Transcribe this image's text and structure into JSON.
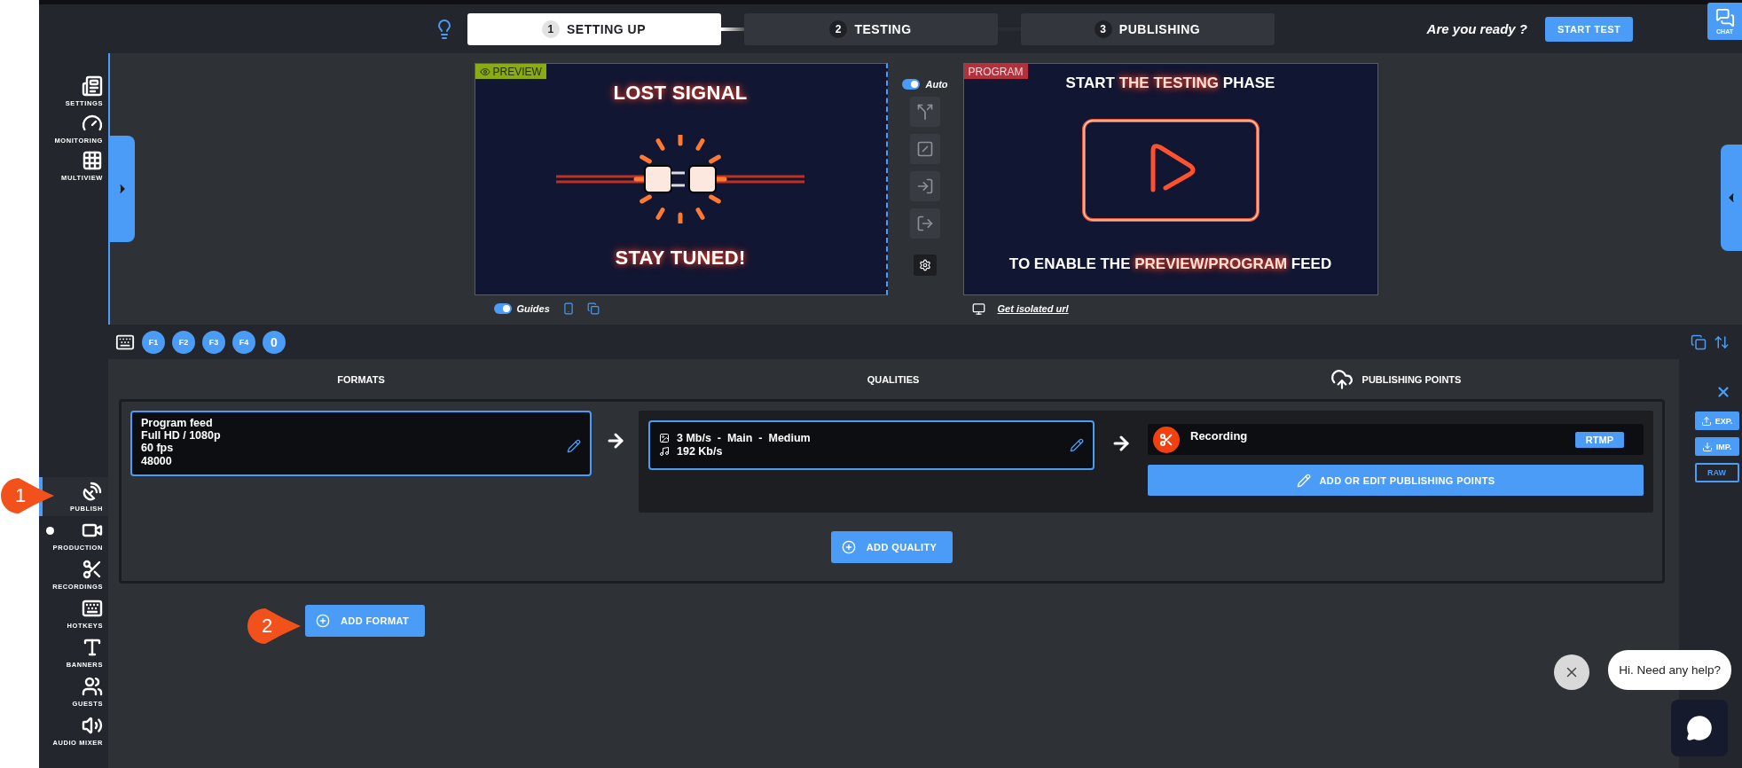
{
  "header": {
    "steps": [
      {
        "number": "1",
        "label": "SETTING UP",
        "selected": true
      },
      {
        "number": "2",
        "label": "TESTING",
        "selected": false
      },
      {
        "number": "3",
        "label": "PUBLISHING",
        "selected": false
      }
    ],
    "prompt": "Are you ready ?",
    "start_button": "START TEST",
    "chat_button": "CHAT"
  },
  "sidebar": {
    "top_items": [
      {
        "label": "SETTINGS",
        "selected": false,
        "live": false
      },
      {
        "label": "MONITORING",
        "selected": false,
        "live": false
      },
      {
        "label": "MULTIVIEW",
        "selected": false,
        "live": false
      }
    ],
    "bottom_items": [
      {
        "label": "PUBLISH",
        "selected": true,
        "live": false
      },
      {
        "label": "PRODUCTION",
        "selected": false,
        "live": true
      },
      {
        "label": "RECORDINGS",
        "selected": false,
        "live": false
      },
      {
        "label": "HOTKEYS",
        "selected": false,
        "live": false
      },
      {
        "label": "BANNERS",
        "selected": false,
        "live": false
      },
      {
        "label": "GUESTS",
        "selected": false,
        "live": false
      },
      {
        "label": "AUDIO MIXER",
        "selected": false,
        "live": false
      }
    ]
  },
  "preview": {
    "label": "PREVIEW",
    "title": "LOST SIGNAL",
    "subtitle": "STAY TUNED!",
    "guides": {
      "label": "Guides",
      "on": true
    }
  },
  "auto": {
    "label": "Auto",
    "on": true
  },
  "program": {
    "label": "PROGRAM",
    "headline": [
      {
        "text": "START ",
        "highlight": false
      },
      {
        "text": "THE TESTING",
        "highlight": true
      },
      {
        "text": " PHASE",
        "highlight": false
      }
    ],
    "footer": [
      {
        "text": "TO ENABLE THE ",
        "highlight": false
      },
      {
        "text": "PREVIEW/PROGRAM",
        "highlight": true
      },
      {
        "text": " FEED",
        "highlight": false
      }
    ],
    "link": "Get isolated url"
  },
  "hotkeys": [
    "F1",
    "F2",
    "F3",
    "F4",
    "0"
  ],
  "columns": [
    "FORMATS",
    "QUALITIES",
    "PUBLISHING POINTS"
  ],
  "format": {
    "lines": [
      "Program feed",
      "Full HD / 1080p",
      "60 fps",
      "48000"
    ]
  },
  "quality": {
    "video": "3 Mb/s  -  Main  -  Medium",
    "audio": "192 Kb/s"
  },
  "publishing_point": {
    "name": "Recording",
    "protocol": "RTMP",
    "edit_button": "ADD OR EDIT PUBLISHING POINTS"
  },
  "add_quality": "ADD QUALITY",
  "add_format": "ADD FORMAT",
  "rail": {
    "buttons": [
      {
        "label": "EXP.",
        "kind": "export"
      },
      {
        "label": "IMP.",
        "kind": "import"
      },
      {
        "label": "RAW",
        "kind": "outline"
      }
    ]
  },
  "annotations": [
    "1",
    "2"
  ],
  "chat_widget": {
    "message": "Hi. Need any help?"
  }
}
